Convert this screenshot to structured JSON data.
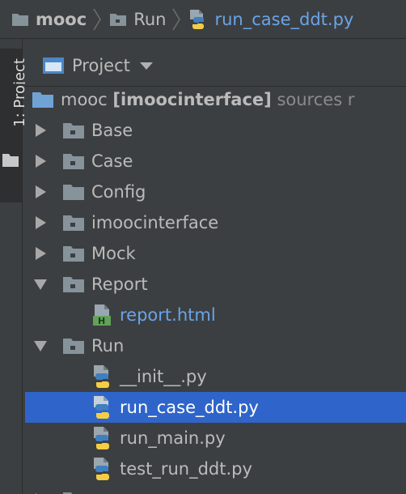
{
  "breadcrumb": {
    "root": "mooc",
    "folder": "Run",
    "file": "run_case_ddt.py"
  },
  "tool_strip": {
    "project_tab": "1: Project"
  },
  "panel": {
    "title": "Project",
    "view_selector_icon": "chevron-down-icon"
  },
  "tree": {
    "root": {
      "name": "mooc",
      "module": "[imoocinterface]",
      "suffix": "sources r"
    },
    "folders": {
      "base": "Base",
      "case": "Case",
      "config": "Config",
      "imoocinterface": "imoocinterface",
      "mock": "Mock",
      "report": "Report",
      "run": "Run"
    },
    "report_files": {
      "report_html": "report.html"
    },
    "run_files": {
      "init": "__init__.py",
      "run_case_ddt": "run_case_ddt.py",
      "run_main": "run_main.py",
      "test_run_ddt": "test_run_ddt.py"
    },
    "selected": "run_case_ddt.py"
  },
  "colors": {
    "background": "#3c3f41",
    "selection": "#2f65ca",
    "link_blue": "#6aa4e8",
    "text": "#bbbbbb"
  }
}
